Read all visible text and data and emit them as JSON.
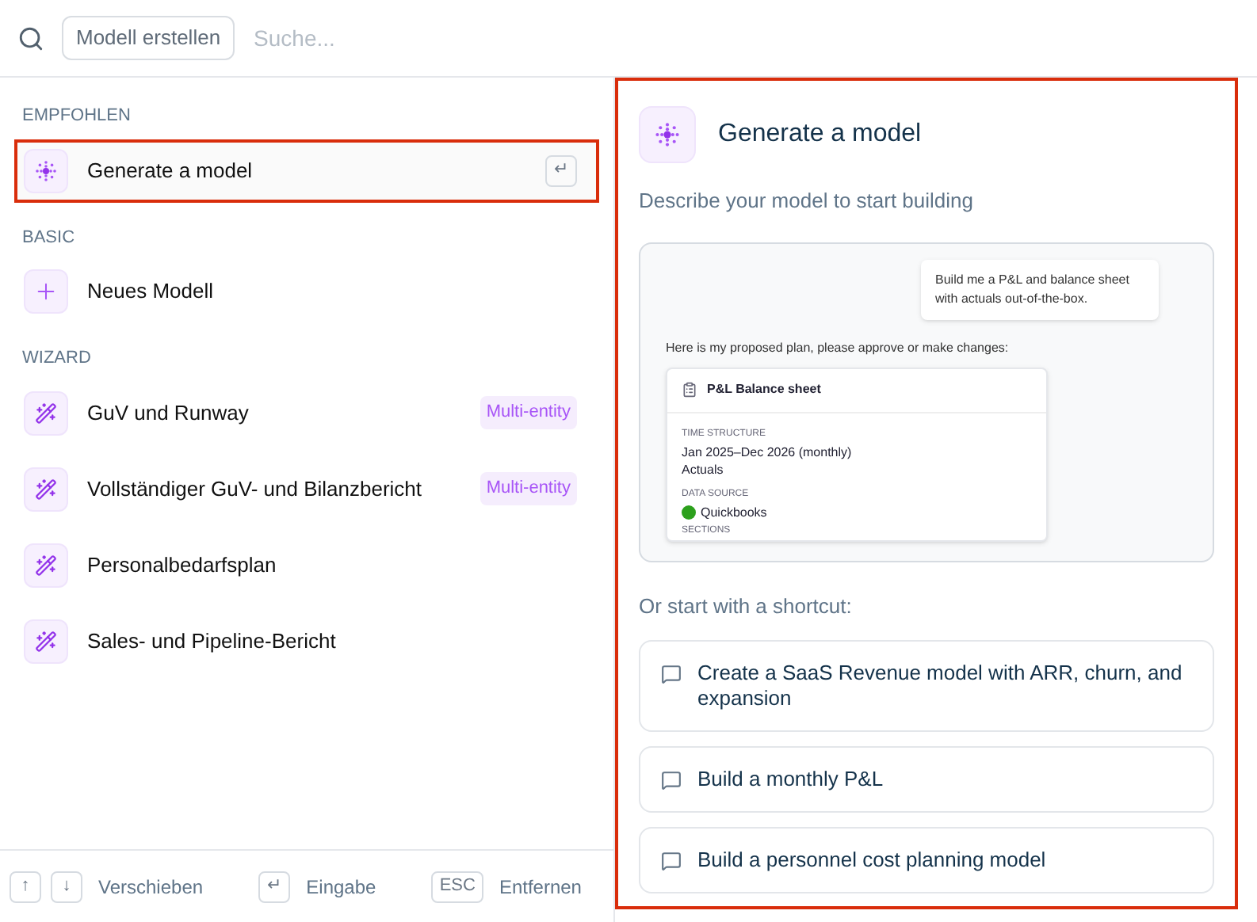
{
  "search_bar": {
    "chip": "Modell erstellen",
    "placeholder": "Suche..."
  },
  "sections": [
    {
      "heading": "EMPFOHLEN",
      "items": [
        {
          "kind": "ai",
          "label": "Generate a model",
          "selected": true,
          "shortcut": "↵"
        }
      ]
    },
    {
      "heading": "BASIC",
      "items": [
        {
          "kind": "plus",
          "label": "Neues Modell",
          "selected": false
        }
      ]
    },
    {
      "heading": "WIZARD",
      "items": [
        {
          "kind": "wand",
          "label": "GuV und Runway",
          "selected": false,
          "badge": "Multi-entity"
        },
        {
          "kind": "wand",
          "label": "Vollständiger GuV- und Bilanzbericht",
          "selected": false,
          "badge": "Multi-entity"
        },
        {
          "kind": "wand",
          "label": "Personalbedarfsplan",
          "selected": false
        },
        {
          "kind": "wand",
          "label": "Sales- und Pipeline-Bericht",
          "selected": false
        }
      ]
    }
  ],
  "footer": [
    {
      "keys": [
        "↑",
        "↓"
      ],
      "label": "Verschieben"
    },
    {
      "keys": [
        "↵"
      ],
      "label": "Eingabe"
    },
    {
      "keys": [
        "ESC"
      ],
      "label": "Entfernen"
    }
  ],
  "detail": {
    "title": "Generate a model",
    "subtitle": "Describe your model to start building",
    "preview": {
      "user_message": "Build me a P&L and balance sheet with actuals out-of-the-box.",
      "reply": "Here is my proposed plan, please approve or make changes:",
      "plan_title": "P&L Balance sheet",
      "time_label": "TIME STRUCTURE",
      "time_range": "Jan 2025–Dec 2026 (monthly)",
      "time_type": "Actuals",
      "source_label": "DATA SOURCE",
      "source": "Quickbooks",
      "sections_label": "SECTIONS"
    },
    "shortcut_heading": "Or start with a shortcut:",
    "shortcuts": [
      "Create a SaaS Revenue model with ARR, churn, and expansion",
      "Build a monthly P&L",
      "Build a personnel cost planning model"
    ]
  }
}
